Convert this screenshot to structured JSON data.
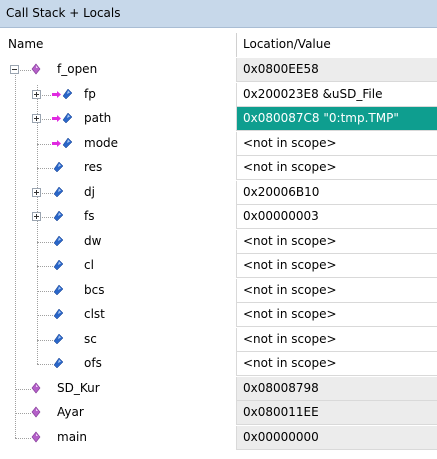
{
  "window": {
    "title": "Call Stack + Locals"
  },
  "columns": {
    "name": "Name",
    "location_value": "Location/Value"
  },
  "colors": {
    "highlight": "#0e9e8f",
    "diamond": "#b460c8",
    "var_blue": "#2a66c8",
    "arrow_magenta": "#e02ae0"
  },
  "rows": [
    {
      "name": "f_open",
      "value": "0x0800EE58",
      "icon": "function-diamond-icon",
      "expander": "minus"
    },
    {
      "name": "fp",
      "value": "0x200023E8 &uSD_File",
      "icon": "pointer-variable-icon",
      "expander": "plus"
    },
    {
      "name": "path",
      "value": "0x080087C8 \"0:tmp.TMP\"",
      "icon": "pointer-variable-icon",
      "expander": "plus",
      "highlighted": true
    },
    {
      "name": "mode",
      "value": "<not in scope>",
      "icon": "pointer-variable-icon"
    },
    {
      "name": "res",
      "value": "<not in scope>",
      "icon": "variable-icon"
    },
    {
      "name": "dj",
      "value": "0x20006B10",
      "icon": "variable-icon",
      "expander": "plus"
    },
    {
      "name": "fs",
      "value": "0x00000003",
      "icon": "variable-icon",
      "expander": "plus"
    },
    {
      "name": "dw",
      "value": "<not in scope>",
      "icon": "variable-icon"
    },
    {
      "name": "cl",
      "value": "<not in scope>",
      "icon": "variable-icon"
    },
    {
      "name": "bcs",
      "value": "<not in scope>",
      "icon": "variable-icon"
    },
    {
      "name": "clst",
      "value": "<not in scope>",
      "icon": "variable-icon"
    },
    {
      "name": "sc",
      "value": "<not in scope>",
      "icon": "variable-icon"
    },
    {
      "name": "ofs",
      "value": "<not in scope>",
      "icon": "variable-icon"
    },
    {
      "name": "SD_Kur",
      "value": "0x08008798",
      "icon": "function-diamond-icon"
    },
    {
      "name": "Ayar",
      "value": "0x080011EE",
      "icon": "function-diamond-icon"
    },
    {
      "name": "main",
      "value": "0x00000000",
      "icon": "function-diamond-icon"
    }
  ]
}
